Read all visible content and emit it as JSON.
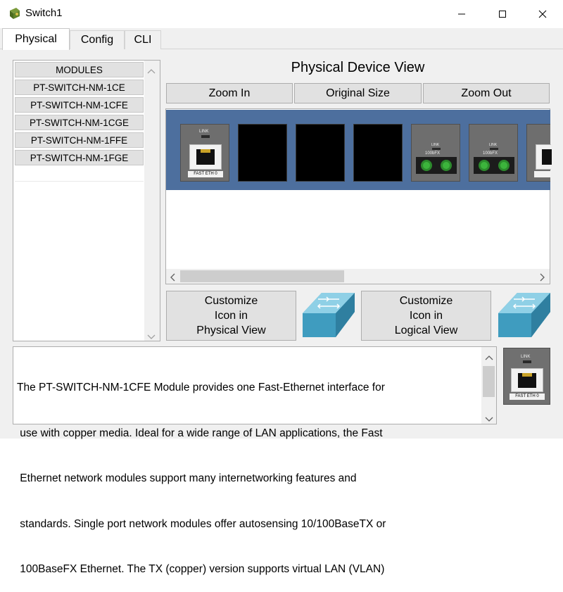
{
  "window": {
    "title": "Switch1",
    "minimize_glyph": "—",
    "maximize_glyph": "☐",
    "close_glyph": "✕"
  },
  "tabs": [
    {
      "label": "Physical",
      "active": true
    },
    {
      "label": "Config",
      "active": false
    },
    {
      "label": "CLI",
      "active": false
    }
  ],
  "modules": {
    "header": "MODULES",
    "items": [
      "PT-SWITCH-NM-1CE",
      "PT-SWITCH-NM-1CFE",
      "PT-SWITCH-NM-1CGE",
      "PT-SWITCH-NM-1FFE",
      "PT-SWITCH-NM-1FGE"
    ]
  },
  "physical_view": {
    "title": "Physical Device View",
    "zoom_in": "Zoom In",
    "original_size": "Original Size",
    "zoom_out": "Zoom Out",
    "port_labels": {
      "link": "LINK",
      "fast_eth": "FAST ETH 0",
      "fiber": "100bFX"
    }
  },
  "customize": {
    "physical": [
      "Customize",
      "Icon in",
      "Physical View"
    ],
    "logical": [
      "Customize",
      "Icon in",
      "Logical View"
    ]
  },
  "description": {
    "lines": [
      "The PT-SWITCH-NM-1CFE Module provides one Fast-Ethernet interface for",
      " use with copper media. Ideal for a wide range of LAN applications, the Fast",
      " Ethernet network modules support many internetworking features and",
      " standards. Single port network modules offer autosensing 10/100BaseTX or",
      " 100BaseFX Ethernet. The TX (copper) version supports virtual LAN (VLAN)"
    ]
  },
  "colors": {
    "device_panel": "#4d6f9e",
    "switch_icon": "#3f9cbf",
    "fiber_port": "#3cb43c"
  }
}
